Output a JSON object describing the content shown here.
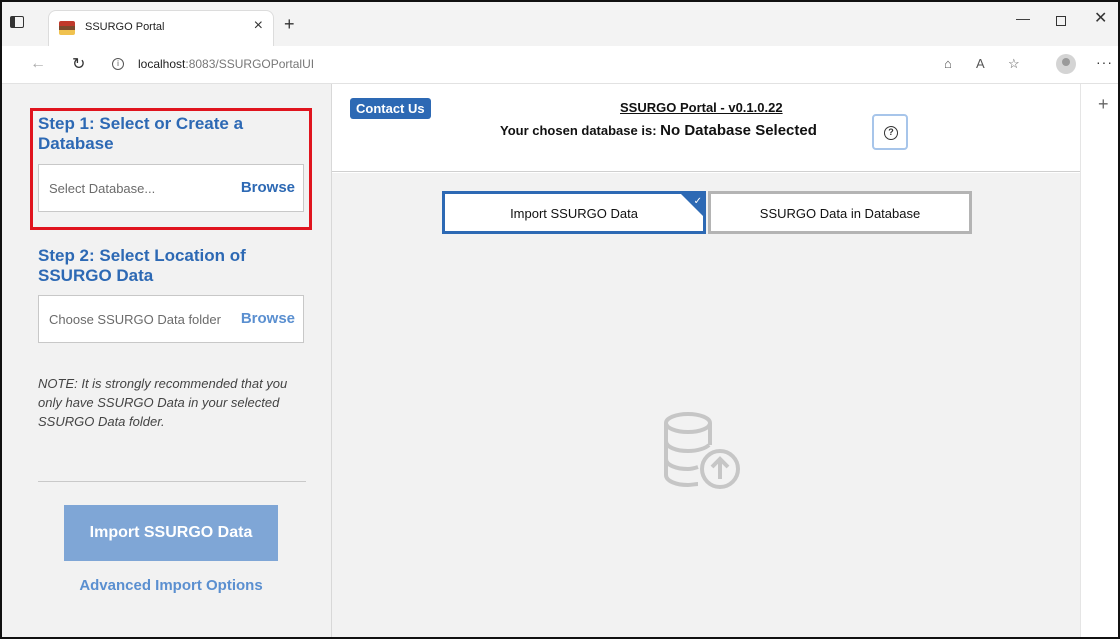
{
  "browser": {
    "tab_title": "SSURGO Portal",
    "tab_close": "×",
    "new_tab": "+",
    "url_host": "localhost",
    "url_path": ":8083/SSURGOPortalUI",
    "window_min": "—",
    "window_close": "✕",
    "more": "···",
    "side_plus": "+"
  },
  "sidebar": {
    "step1_title": "Step 1: Select or Create a Database",
    "step1_placeholder": "Select Database...",
    "step1_browse": "Browse",
    "step2_title": "Step 2: Select Location of SSURGO Data",
    "step2_placeholder": "Choose SSURGO Data folder",
    "step2_browse": "Browse",
    "note": "NOTE: It is strongly recommended that you only have SSURGO Data in your selected SSURGO Data folder.",
    "import_button": "Import SSURGO Data",
    "advanced_link": "Advanced Import Options"
  },
  "header": {
    "contact_button": "Contact Us",
    "title": "SSURGO Portal - v0.1.0.22",
    "db_label": "Your chosen database is:",
    "db_value": "No Database Selected",
    "help_icon": "?"
  },
  "tabs": {
    "import_tab": "Import SSURGO Data",
    "data_tab": "SSURGO Data in Database",
    "active_check": "✓"
  },
  "colors": {
    "accent": "#2d69b4",
    "highlight_box": "#e0141e",
    "disabled_button": "#7fa6d6"
  }
}
